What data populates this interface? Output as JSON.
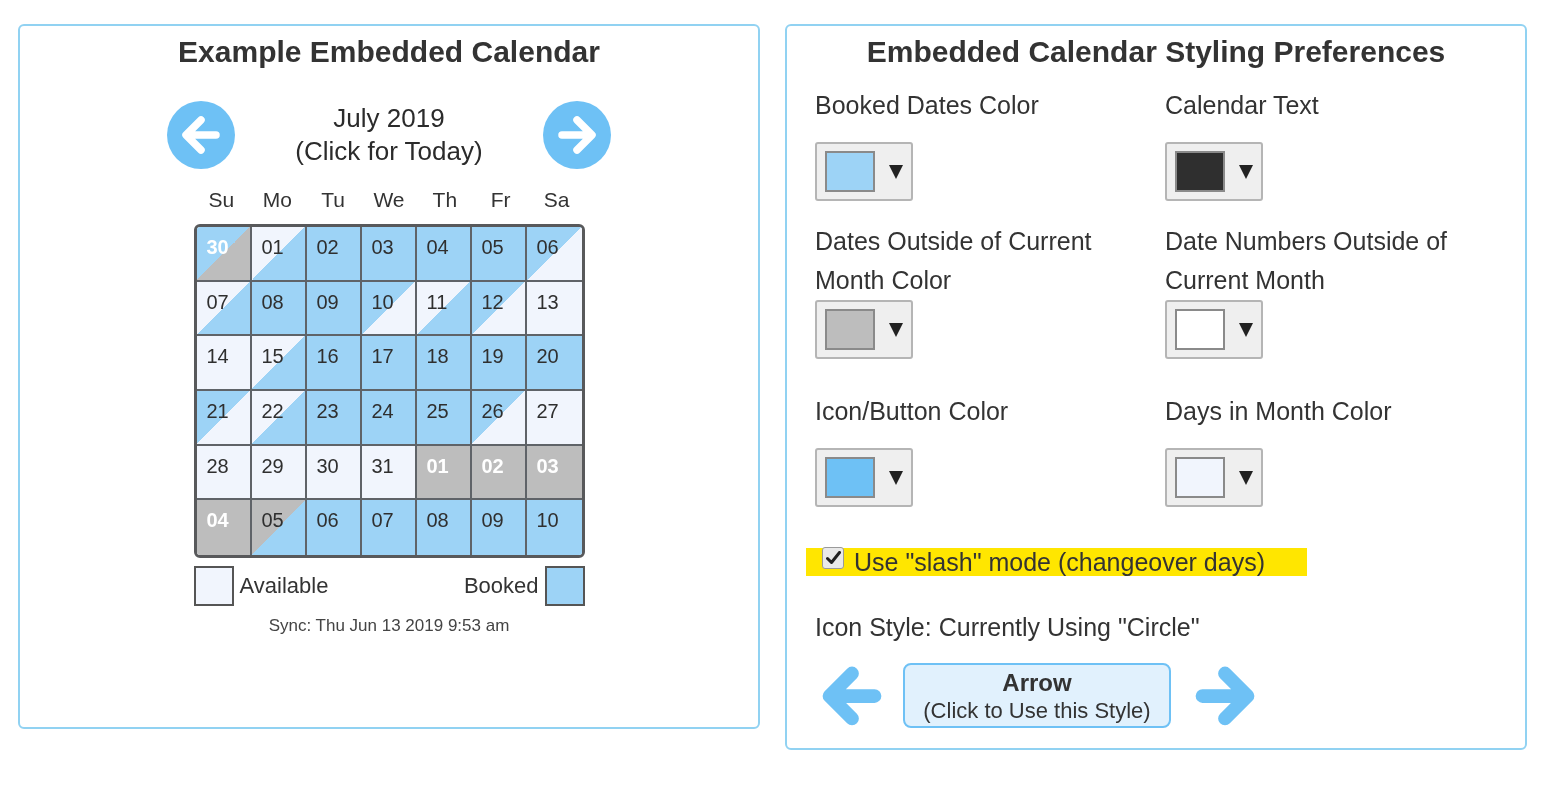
{
  "calendar_panel": {
    "title": "Example Embedded Calendar",
    "month": "July 2019",
    "today_hint": "(Click for Today)",
    "weekdays": [
      "Su",
      "Mo",
      "Tu",
      "We",
      "Th",
      "Fr",
      "Sa"
    ],
    "weeks": [
      [
        {
          "number": "30",
          "booked_morning": true,
          "booked_afternoon": false,
          "outside_morning": false,
          "outside_afternoon": true
        },
        {
          "number": "01",
          "booked_morning": false,
          "booked_afternoon": true,
          "outside_morning": false,
          "outside_afternoon": false
        },
        {
          "number": "02",
          "booked_morning": true,
          "booked_afternoon": true,
          "outside_morning": false,
          "outside_afternoon": false
        },
        {
          "number": "03",
          "booked_morning": true,
          "booked_afternoon": true,
          "outside_morning": false,
          "outside_afternoon": false
        },
        {
          "number": "04",
          "booked_morning": true,
          "booked_afternoon": true,
          "outside_morning": false,
          "outside_afternoon": false
        },
        {
          "number": "05",
          "booked_morning": true,
          "booked_afternoon": true,
          "outside_morning": false,
          "outside_afternoon": false
        },
        {
          "number": "06",
          "booked_morning": true,
          "booked_afternoon": false,
          "outside_morning": false,
          "outside_afternoon": false
        }
      ],
      [
        {
          "number": "07",
          "booked_morning": false,
          "booked_afternoon": true,
          "outside_morning": false,
          "outside_afternoon": false
        },
        {
          "number": "08",
          "booked_morning": true,
          "booked_afternoon": true,
          "outside_morning": false,
          "outside_afternoon": false
        },
        {
          "number": "09",
          "booked_morning": true,
          "booked_afternoon": true,
          "outside_morning": false,
          "outside_afternoon": false
        },
        {
          "number": "10",
          "booked_morning": true,
          "booked_afternoon": false,
          "outside_morning": false,
          "outside_afternoon": false
        },
        {
          "number": "11",
          "booked_morning": false,
          "booked_afternoon": true,
          "outside_morning": false,
          "outside_afternoon": false
        },
        {
          "number": "12",
          "booked_morning": true,
          "booked_afternoon": false,
          "outside_morning": false,
          "outside_afternoon": false
        },
        {
          "number": "13",
          "booked_morning": false,
          "booked_afternoon": false,
          "outside_morning": false,
          "outside_afternoon": false
        }
      ],
      [
        {
          "number": "14",
          "booked_morning": false,
          "booked_afternoon": false,
          "outside_morning": false,
          "outside_afternoon": false
        },
        {
          "number": "15",
          "booked_morning": false,
          "booked_afternoon": true,
          "outside_morning": false,
          "outside_afternoon": false
        },
        {
          "number": "16",
          "booked_morning": true,
          "booked_afternoon": true,
          "outside_morning": false,
          "outside_afternoon": false
        },
        {
          "number": "17",
          "booked_morning": true,
          "booked_afternoon": true,
          "outside_morning": false,
          "outside_afternoon": false
        },
        {
          "number": "18",
          "booked_morning": true,
          "booked_afternoon": true,
          "outside_morning": false,
          "outside_afternoon": false
        },
        {
          "number": "19",
          "booked_morning": true,
          "booked_afternoon": true,
          "outside_morning": false,
          "outside_afternoon": false
        },
        {
          "number": "20",
          "booked_morning": true,
          "booked_afternoon": true,
          "outside_morning": false,
          "outside_afternoon": false
        }
      ],
      [
        {
          "number": "21",
          "booked_morning": true,
          "booked_afternoon": false,
          "outside_morning": false,
          "outside_afternoon": false
        },
        {
          "number": "22",
          "booked_morning": false,
          "booked_afternoon": true,
          "outside_morning": false,
          "outside_afternoon": false
        },
        {
          "number": "23",
          "booked_morning": true,
          "booked_afternoon": true,
          "outside_morning": false,
          "outside_afternoon": false
        },
        {
          "number": "24",
          "booked_morning": true,
          "booked_afternoon": true,
          "outside_morning": false,
          "outside_afternoon": false
        },
        {
          "number": "25",
          "booked_morning": true,
          "booked_afternoon": true,
          "outside_morning": false,
          "outside_afternoon": false
        },
        {
          "number": "26",
          "booked_morning": true,
          "booked_afternoon": false,
          "outside_morning": false,
          "outside_afternoon": false
        },
        {
          "number": "27",
          "booked_morning": false,
          "booked_afternoon": false,
          "outside_morning": false,
          "outside_afternoon": false
        }
      ],
      [
        {
          "number": "28",
          "booked_morning": false,
          "booked_afternoon": false,
          "outside_morning": false,
          "outside_afternoon": false
        },
        {
          "number": "29",
          "booked_morning": false,
          "booked_afternoon": false,
          "outside_morning": false,
          "outside_afternoon": false
        },
        {
          "number": "30",
          "booked_morning": false,
          "booked_afternoon": false,
          "outside_morning": false,
          "outside_afternoon": false
        },
        {
          "number": "31",
          "booked_morning": false,
          "booked_afternoon": false,
          "outside_morning": false,
          "outside_afternoon": false
        },
        {
          "number": "01",
          "booked_morning": false,
          "booked_afternoon": false,
          "outside_morning": true,
          "outside_afternoon": true
        },
        {
          "number": "02",
          "booked_morning": false,
          "booked_afternoon": false,
          "outside_morning": true,
          "outside_afternoon": true
        },
        {
          "number": "03",
          "booked_morning": false,
          "booked_afternoon": false,
          "outside_morning": true,
          "outside_afternoon": true
        }
      ],
      [
        {
          "number": "04",
          "booked_morning": false,
          "booked_afternoon": false,
          "outside_morning": true,
          "outside_afternoon": true
        },
        {
          "number": "05",
          "booked_morning": false,
          "booked_afternoon": true,
          "outside_morning": true,
          "outside_afternoon": false
        },
        {
          "number": "06",
          "booked_morning": true,
          "booked_afternoon": true,
          "outside_morning": false,
          "outside_afternoon": false
        },
        {
          "number": "07",
          "booked_morning": true,
          "booked_afternoon": true,
          "outside_morning": false,
          "outside_afternoon": false
        },
        {
          "number": "08",
          "booked_morning": true,
          "booked_afternoon": true,
          "outside_morning": false,
          "outside_afternoon": false
        },
        {
          "number": "09",
          "booked_morning": true,
          "booked_afternoon": true,
          "outside_morning": false,
          "outside_afternoon": false
        },
        {
          "number": "10",
          "booked_morning": true,
          "booked_afternoon": true,
          "outside_morning": false,
          "outside_afternoon": false
        }
      ]
    ],
    "legend": [
      {
        "label": "Available",
        "booked": false
      },
      {
        "label": "Booked",
        "booked": true
      }
    ],
    "sync": "Sync: Thu Jun 13 2019 9:53 am"
  },
  "preferences_panel": {
    "title": "Embedded Calendar Styling Preferences",
    "settings": [
      {
        "label": "Booked Dates Color",
        "kind": "booked",
        "color": "#9dd3f6"
      },
      {
        "label": "Calendar Text",
        "kind": "text",
        "color": "#2f2f2f"
      },
      {
        "label": "Dates Outside of Current Month Color",
        "kind": "outside",
        "color": "#bdbdbd"
      },
      {
        "label": "Date Numbers Outside of Current Month",
        "kind": "outside_text",
        "color": "#ffffff"
      },
      {
        "label": "Icon/Button Color",
        "kind": "icon",
        "color": "#6ec1f5"
      },
      {
        "label": "Days in Month Color",
        "kind": "available",
        "color": "#f1f5fd"
      }
    ],
    "slash_mode": {
      "label": "Use \"slash\" mode (changeover days)",
      "checked": true,
      "highlighted": true
    },
    "icon_style": {
      "label": "Icon Style: Currently Using \"Circle\"",
      "option": "Arrow",
      "action": "(Click to Use this Style)"
    }
  }
}
